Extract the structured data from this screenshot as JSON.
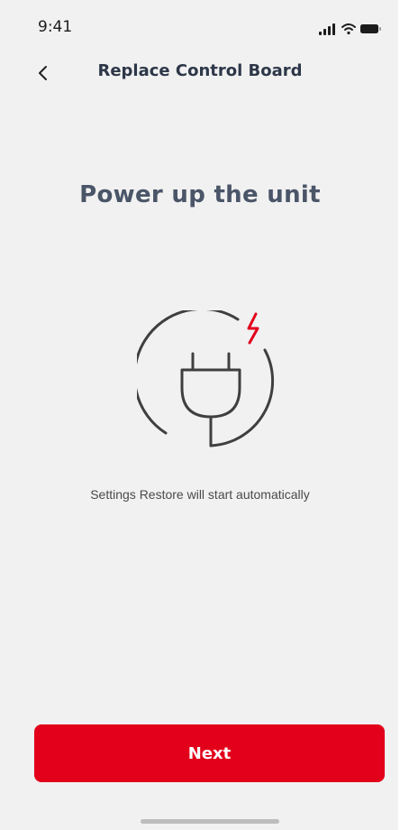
{
  "status_bar": {
    "time": "9:41",
    "icons": [
      "signal-icon",
      "wifi-icon",
      "battery-icon"
    ]
  },
  "nav": {
    "back_icon": "chevron-left-icon",
    "title": "Replace Control Board"
  },
  "main": {
    "headline": "Power up the unit",
    "illustration_icon": "power-plug-icon",
    "caption": "Settings Restore will start automatically"
  },
  "actions": {
    "next_label": "Next"
  },
  "colors": {
    "accent": "#e2001a",
    "background": "#f1f1f1",
    "title_text": "#2d3748",
    "headline_text": "#4a5568"
  }
}
